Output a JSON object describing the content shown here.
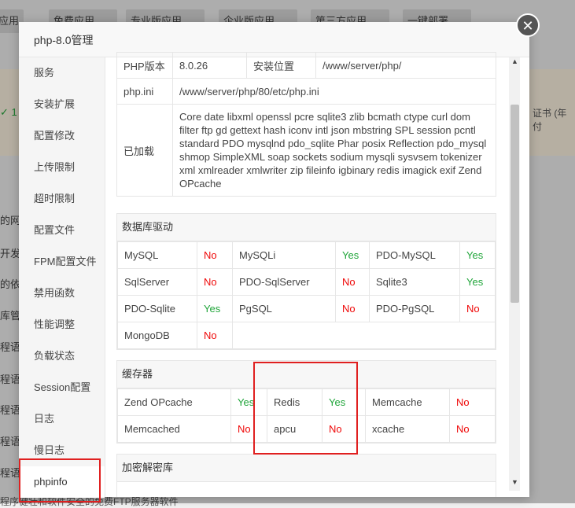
{
  "background": {
    "tabs": [
      "应用",
      "免费应用",
      "专业版应用",
      "企业版应用",
      "第三方应用",
      "一键部署"
    ],
    "notice_left": "✓ 1",
    "notice_right": "证书 (年付",
    "left_fragments": [
      "的网",
      "开发",
      "的依",
      "库管",
      "程语",
      "程语",
      "程语",
      "程语",
      "程语"
    ],
    "bottom_text": "程序健壮和软件安全的免费FTP服务器软件"
  },
  "modal": {
    "title": "php-8.0管理",
    "close_label": "✕"
  },
  "sidebar": {
    "items": [
      {
        "label": "服务"
      },
      {
        "label": "安装扩展"
      },
      {
        "label": "配置修改"
      },
      {
        "label": "上传限制"
      },
      {
        "label": "超时限制"
      },
      {
        "label": "配置文件"
      },
      {
        "label": "FPM配置文件"
      },
      {
        "label": "禁用函数"
      },
      {
        "label": "性能调整"
      },
      {
        "label": "负载状态"
      },
      {
        "label": "Session配置"
      },
      {
        "label": "日志"
      },
      {
        "label": "慢日志"
      },
      {
        "label": "phpinfo"
      }
    ],
    "active": "phpinfo"
  },
  "info": {
    "php_version_label": "PHP版本",
    "php_version": "8.0.26",
    "install_path_label": "安装位置",
    "install_path": "/www/server/php/",
    "php_ini_label": "php.ini",
    "php_ini": "/www/server/php/80/etc/php.ini",
    "loaded_label": "已加载",
    "loaded_extensions": "Core date libxml openssl pcre sqlite3 zlib bcmath ctype curl dom filter ftp gd gettext hash iconv intl json mbstring SPL session pcntl standard PDO mysqlnd pdo_sqlite Phar posix Reflection pdo_mysql shmop SimpleXML soap sockets sodium mysqli sysvsem tokenizer xml xmlreader xmlwriter zip fileinfo igbinary redis imagick exif Zend OPcache"
  },
  "db_drivers": {
    "title": "数据库驱动",
    "rows": [
      [
        {
          "name": "MySQL",
          "status": "No"
        },
        {
          "name": "MySQLi",
          "status": "Yes"
        },
        {
          "name": "PDO-MySQL",
          "status": "Yes"
        }
      ],
      [
        {
          "name": "SqlServer",
          "status": "No"
        },
        {
          "name": "PDO-SqlServer",
          "status": "No"
        },
        {
          "name": "Sqlite3",
          "status": "Yes"
        }
      ],
      [
        {
          "name": "PDO-Sqlite",
          "status": "Yes"
        },
        {
          "name": "PgSQL",
          "status": "No"
        },
        {
          "name": "PDO-PgSQL",
          "status": "No"
        }
      ],
      [
        {
          "name": "MongoDB",
          "status": "No"
        }
      ]
    ]
  },
  "cache": {
    "title": "缓存器",
    "rows": [
      [
        {
          "name": "Zend OPcache",
          "status": "Yes"
        },
        {
          "name": "Redis",
          "status": "Yes"
        },
        {
          "name": "Memcache",
          "status": "No"
        }
      ],
      [
        {
          "name": "Memcached",
          "status": "No"
        },
        {
          "name": "apcu",
          "status": "No"
        },
        {
          "name": "xcache",
          "status": "No"
        }
      ]
    ]
  },
  "crypto": {
    "title": "加密解密库"
  },
  "colors": {
    "yes": "#20a53a",
    "no": "#ef0808",
    "highlight_box": "#e02020"
  }
}
